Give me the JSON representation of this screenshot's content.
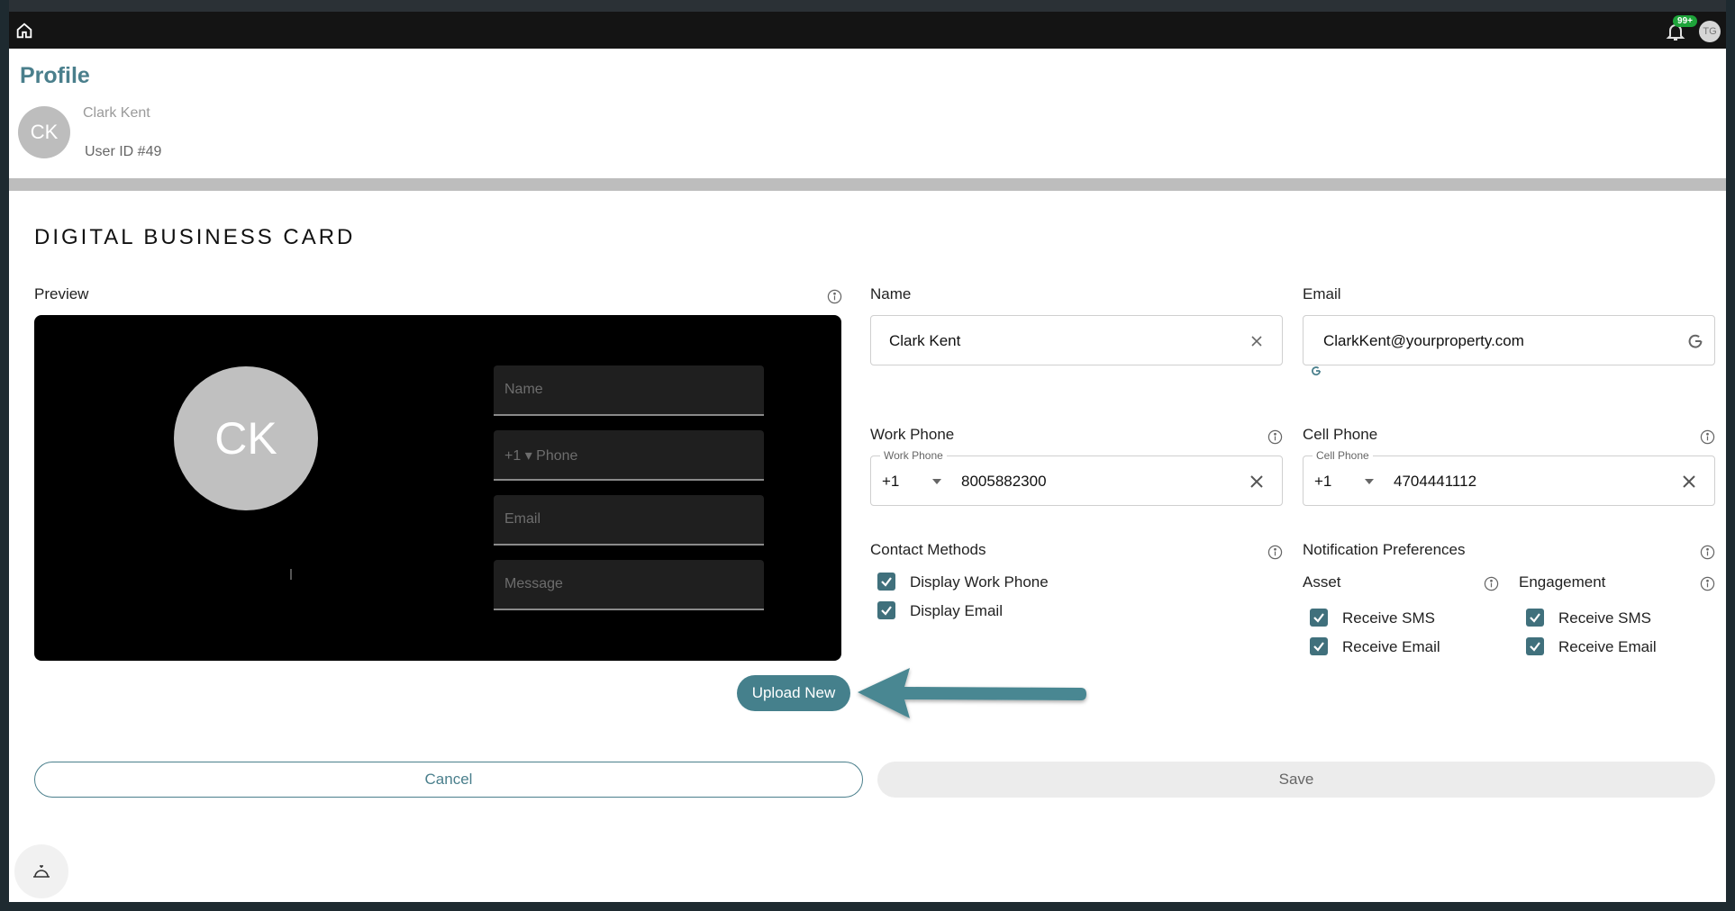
{
  "page": {
    "title": "Profile",
    "user": {
      "initials": "CK",
      "name": "Clark Kent",
      "user_id": "User ID #49"
    },
    "header": {
      "notifications_badge": "99+",
      "user_initials": "TG"
    }
  },
  "card": {
    "section_title": "DIGITAL BUSINESS CARD",
    "preview_label": "Preview",
    "preview": {
      "initials": "CK",
      "name_placeholder": "Name",
      "phone_placeholder": "+1 ▾ Phone",
      "email_placeholder": "Email",
      "message_placeholder": "Message"
    },
    "upload_label": "Upload New"
  },
  "form": {
    "name": {
      "label": "Name",
      "value": "Clark Kent"
    },
    "email": {
      "label": "Email",
      "value": "ClarkKent@yourproperty.com"
    },
    "work_phone": {
      "label": "Work Phone",
      "legend": "Work Phone",
      "code": "+1",
      "value": "8005882300"
    },
    "cell_phone": {
      "label": "Cell Phone",
      "legend": "Cell Phone",
      "code": "+1",
      "value": "4704441112"
    },
    "contact_methods": {
      "label": "Contact Methods",
      "items": [
        {
          "label": "Display Work Phone",
          "checked": true
        },
        {
          "label": "Display Email",
          "checked": true
        }
      ]
    },
    "notifications": {
      "label": "Notification Preferences",
      "asset": {
        "label": "Asset",
        "sms": "Receive SMS",
        "email": "Receive Email"
      },
      "engagement": {
        "label": "Engagement",
        "sms": "Receive SMS",
        "email": "Receive Email"
      }
    }
  },
  "actions": {
    "cancel": "Cancel",
    "save": "Save"
  },
  "colors": {
    "accent": "#45808c",
    "topbar": "#141414",
    "badge": "#1ea33a"
  }
}
